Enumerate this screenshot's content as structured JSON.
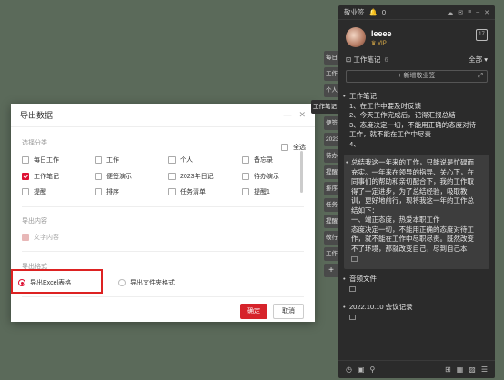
{
  "app": {
    "title": "敬业签",
    "bell_count": "0",
    "titlebar_icons": [
      "cloud-icon",
      "message-icon",
      "menu-icon",
      "minimize-icon",
      "close-icon"
    ],
    "username": "leeee",
    "vip_label": "VIP",
    "category_name": "工作笔记",
    "category_count": "6",
    "category_filter": "全部",
    "new_button_label": "+ 新增敬业签",
    "notes": [
      {
        "lines": [
          "工作笔记",
          "1、在工作中要及时反馈",
          "2、今天工作完成后，记得汇报总结",
          "3、态度决定一切，不能用正确的态度对待",
          "工作，就不能在工作中尽责",
          "4、"
        ]
      },
      {
        "selected": true,
        "lines": [
          "总结我这一年来的工作，只能说是忙碌而",
          "充实。一年来在领导的指导、关心下，在",
          "同事们的帮助和亲切配合下，我的工作取",
          "得了一定进步，为了总结经验，吸取教",
          "训，更好地前行，现将我这一年的工作总",
          "结如下：",
          "一、端正态度，热爱本职工作",
          "态度决定一切，不能用正确的态度对待工",
          "作，就不能在工作中尽职尽责。既然改变",
          "不了环境，那就改变自己，尽到自己本"
        ]
      },
      {
        "lines": [
          "音频文件"
        ]
      },
      {
        "lines": [
          "2022.10.10 会议记录"
        ]
      }
    ]
  },
  "side_tabs": [
    "每日",
    "工作",
    "个人",
    "工作笔记",
    "便签",
    "2023",
    "待办",
    "提醒",
    "排序",
    "任务",
    "提醒",
    "敬行",
    "工作",
    "+"
  ],
  "dialog": {
    "title": "导出数据",
    "section_category": "选择分类",
    "select_all": "全选",
    "categories": [
      {
        "label": "每日工作",
        "checked": false
      },
      {
        "label": "工作",
        "checked": false
      },
      {
        "label": "个人",
        "checked": false
      },
      {
        "label": "备忘录",
        "checked": false
      },
      {
        "label": "工作笔记",
        "checked": true
      },
      {
        "label": "便签演示",
        "checked": false
      },
      {
        "label": "2023年日记",
        "checked": false
      },
      {
        "label": "待办演示",
        "checked": false
      },
      {
        "label": "提醒",
        "checked": false
      },
      {
        "label": "排序",
        "checked": false
      },
      {
        "label": "任务清单",
        "checked": false
      },
      {
        "label": "提醒1",
        "checked": false
      }
    ],
    "section_content": "导出内容",
    "content_option": "文字内容",
    "section_format": "导出格式",
    "format_excel": "导出Excel表格",
    "format_folder": "导出文件夹格式",
    "confirm": "确定",
    "cancel": "取消"
  }
}
